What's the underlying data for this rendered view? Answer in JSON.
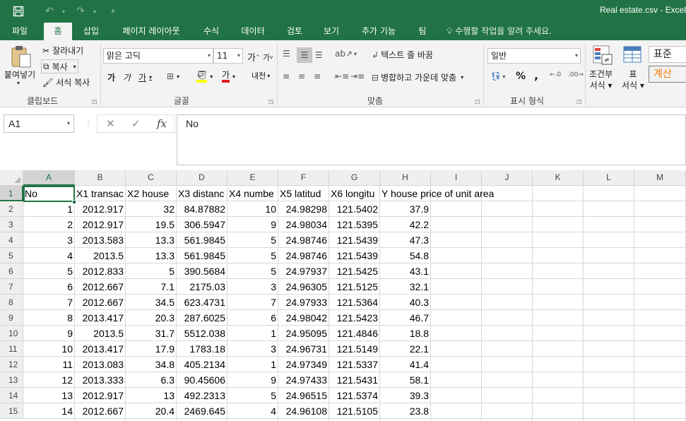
{
  "app": {
    "window_title": "Real estate.csv - Excel",
    "accent_color": "#217346"
  },
  "quick_access": {
    "save_icon": "save-icon",
    "undo_icon": "undo-icon",
    "redo_icon": "redo-icon",
    "customize_icon": "customize-icon"
  },
  "tabs": [
    {
      "label": "파일",
      "active": false
    },
    {
      "label": "홈",
      "active": true
    },
    {
      "label": "삽입",
      "active": false
    },
    {
      "label": "페이지 레이아웃",
      "active": false
    },
    {
      "label": "수식",
      "active": false
    },
    {
      "label": "데이터",
      "active": false
    },
    {
      "label": "검토",
      "active": false
    },
    {
      "label": "보기",
      "active": false
    },
    {
      "label": "추가 기능",
      "active": false
    },
    {
      "label": "팀",
      "active": false
    }
  ],
  "tell_me": "수행할 작업을 알려 주세요.",
  "ribbon": {
    "clipboard": {
      "label": "클립보드",
      "paste": "붙여넣기",
      "cut": "잘라내기",
      "copy": "복사",
      "format_painter": "서식 복사"
    },
    "font": {
      "label": "글꼴",
      "font_name": "맑은 고딕",
      "font_size": "11",
      "grow": "가",
      "shrink": "가",
      "bold": "가",
      "italic": "가",
      "underline": "가",
      "font_color_glyph": "가",
      "phonetic": "내천"
    },
    "alignment": {
      "label": "맞춤",
      "wrap_text": "텍스트 줄 바꿈",
      "merge_center": "병합하고 가운데 맞춤"
    },
    "number": {
      "label": "표시 형식",
      "format": "일반",
      "percent": "%",
      "comma": ","
    },
    "styles": {
      "conditional": "조건부",
      "conditional2": "서식",
      "table": "표",
      "table2": "서식",
      "normal": "표준",
      "calc": "계산"
    }
  },
  "formula_bar": {
    "name_box": "A1",
    "cancel_glyph": "✕",
    "enter_glyph": "✓",
    "fx": "fx",
    "formula": "No"
  },
  "grid": {
    "columns": [
      "A",
      "B",
      "C",
      "D",
      "E",
      "F",
      "G",
      "H",
      "I",
      "J",
      "K",
      "L",
      "M"
    ],
    "rows": [
      "1",
      "2",
      "3",
      "4",
      "5",
      "6",
      "7",
      "8",
      "9",
      "10",
      "11",
      "12",
      "13",
      "14",
      "15"
    ],
    "header_row": [
      "No",
      "X1 transac",
      "X2 house",
      "X3 distanc",
      "X4 numbe",
      "X5 latitud",
      "X6 longitu",
      "Y house price of unit area"
    ],
    "data": [
      [
        "1",
        "2012.917",
        "32",
        "84.87882",
        "10",
        "24.98298",
        "121.5402",
        "37.9"
      ],
      [
        "2",
        "2012.917",
        "19.5",
        "306.5947",
        "9",
        "24.98034",
        "121.5395",
        "42.2"
      ],
      [
        "3",
        "2013.583",
        "13.3",
        "561.9845",
        "5",
        "24.98746",
        "121.5439",
        "47.3"
      ],
      [
        "4",
        "2013.5",
        "13.3",
        "561.9845",
        "5",
        "24.98746",
        "121.5439",
        "54.8"
      ],
      [
        "5",
        "2012.833",
        "5",
        "390.5684",
        "5",
        "24.97937",
        "121.5425",
        "43.1"
      ],
      [
        "6",
        "2012.667",
        "7.1",
        "2175.03",
        "3",
        "24.96305",
        "121.5125",
        "32.1"
      ],
      [
        "7",
        "2012.667",
        "34.5",
        "623.4731",
        "7",
        "24.97933",
        "121.5364",
        "40.3"
      ],
      [
        "8",
        "2013.417",
        "20.3",
        "287.6025",
        "6",
        "24.98042",
        "121.5423",
        "46.7"
      ],
      [
        "9",
        "2013.5",
        "31.7",
        "5512.038",
        "1",
        "24.95095",
        "121.4846",
        "18.8"
      ],
      [
        "10",
        "2013.417",
        "17.9",
        "1783.18",
        "3",
        "24.96731",
        "121.5149",
        "22.1"
      ],
      [
        "11",
        "2013.083",
        "34.8",
        "405.2134",
        "1",
        "24.97349",
        "121.5337",
        "41.4"
      ],
      [
        "12",
        "2013.333",
        "6.3",
        "90.45606",
        "9",
        "24.97433",
        "121.5431",
        "58.1"
      ],
      [
        "13",
        "2012.917",
        "13",
        "492.2313",
        "5",
        "24.96515",
        "121.5374",
        "39.3"
      ],
      [
        "14",
        "2012.667",
        "20.4",
        "2469.645",
        "4",
        "24.96108",
        "121.5105",
        "23.8"
      ]
    ],
    "selected_cell": "A1"
  }
}
